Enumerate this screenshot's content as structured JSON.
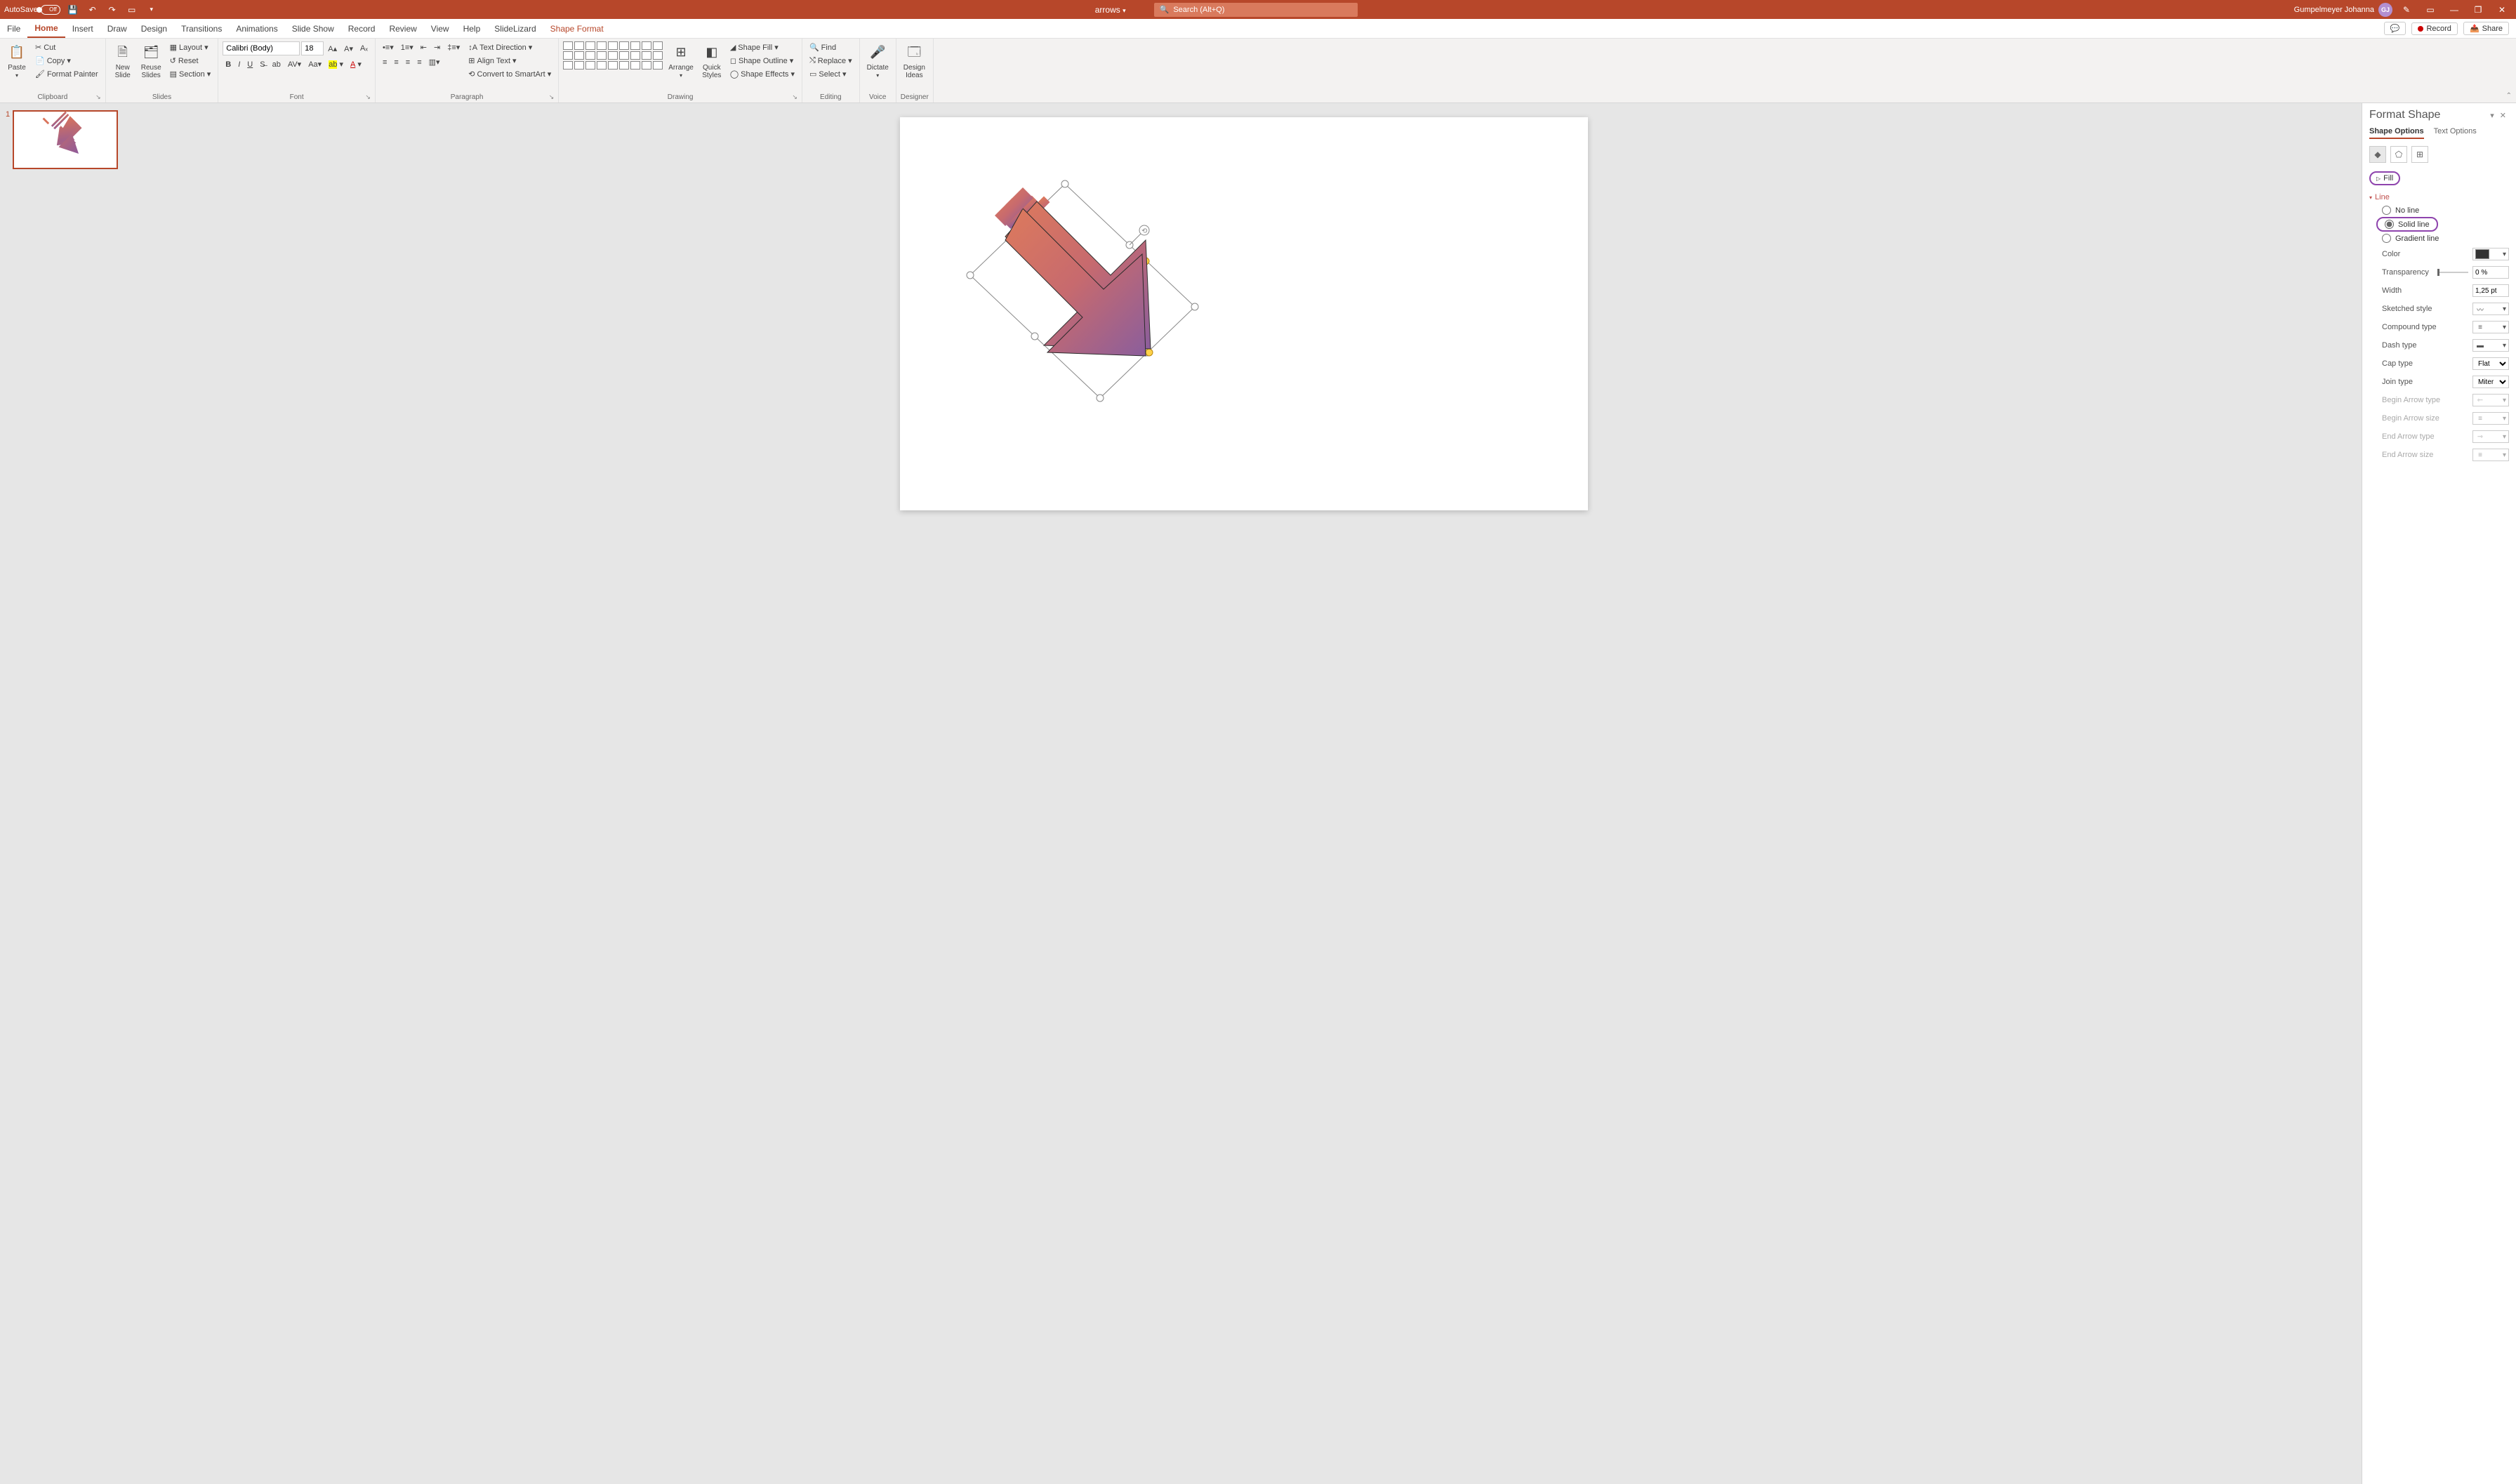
{
  "titlebar": {
    "autosave_label": "AutoSave",
    "autosave_state": "Off",
    "filename": "arrows",
    "search_placeholder": "Search (Alt+Q)",
    "user_name": "Gumpelmeyer Johanna",
    "user_initials": "GJ"
  },
  "tabs": {
    "file": "File",
    "home": "Home",
    "insert": "Insert",
    "draw": "Draw",
    "design": "Design",
    "transitions": "Transitions",
    "animations": "Animations",
    "slideshow": "Slide Show",
    "record": "Record",
    "review": "Review",
    "view": "View",
    "help": "Help",
    "slidelizard": "SlideLizard",
    "shapeformat": "Shape Format",
    "comments": "",
    "record_btn": "Record",
    "share": "Share"
  },
  "ribbon": {
    "clipboard": {
      "label": "Clipboard",
      "paste": "Paste",
      "cut": "Cut",
      "copy": "Copy",
      "format_painter": "Format Painter"
    },
    "slides": {
      "label": "Slides",
      "new_slide": "New\nSlide",
      "reuse": "Reuse\nSlides",
      "layout": "Layout",
      "reset": "Reset",
      "section": "Section"
    },
    "font": {
      "label": "Font",
      "family": "Calibri (Body)",
      "size": "18"
    },
    "paragraph": {
      "label": "Paragraph",
      "text_direction": "Text Direction",
      "align_text": "Align Text",
      "smartart": "Convert to SmartArt"
    },
    "drawing": {
      "label": "Drawing",
      "arrange": "Arrange",
      "quick_styles": "Quick\nStyles",
      "shape_fill": "Shape Fill",
      "shape_outline": "Shape Outline",
      "shape_effects": "Shape Effects"
    },
    "editing": {
      "label": "Editing",
      "find": "Find",
      "replace": "Replace",
      "select": "Select"
    },
    "voice": {
      "label": "Voice",
      "dictate": "Dictate"
    },
    "designer": {
      "label": "Designer",
      "design_ideas": "Design\nIdeas"
    }
  },
  "thumbs": {
    "slide1_num": "1"
  },
  "panel": {
    "title": "Format Shape",
    "tab_shape": "Shape Options",
    "tab_text": "Text Options",
    "fill": "Fill",
    "line": "Line",
    "no_line": "No line",
    "solid_line": "Solid line",
    "gradient_line": "Gradient line",
    "color": "Color",
    "transparency": "Transparency",
    "transparency_val": "0 %",
    "width": "Width",
    "width_val": "1,25 pt",
    "sketched": "Sketched style",
    "compound": "Compound type",
    "dash": "Dash type",
    "cap": "Cap type",
    "cap_val": "Flat",
    "join": "Join type",
    "join_val": "Miter",
    "begin_arrow_type": "Begin Arrow type",
    "begin_arrow_size": "Begin Arrow size",
    "end_arrow_type": "End Arrow type",
    "end_arrow_size": "End Arrow size"
  }
}
